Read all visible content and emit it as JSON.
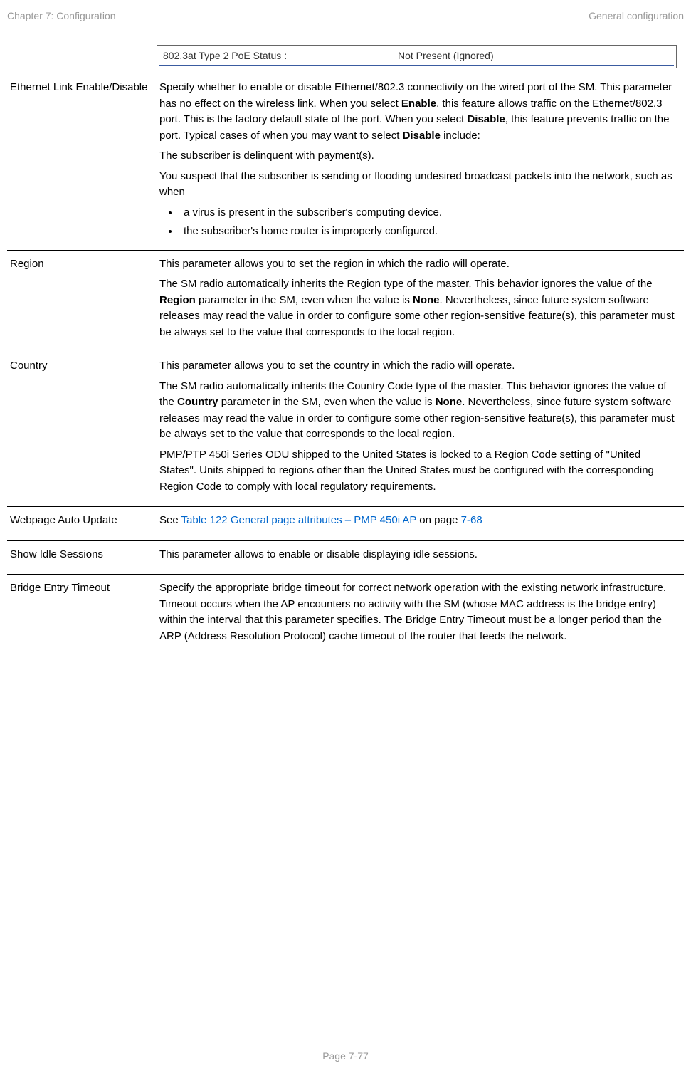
{
  "header": {
    "left": "Chapter 7:  Configuration",
    "right": "General configuration"
  },
  "status": {
    "label": "802.3at Type 2 PoE Status :",
    "value": "Not Present (Ignored)"
  },
  "rows": [
    {
      "term": "Ethernet Link Enable/Disable",
      "paragraphs": [
        {
          "segments": [
            {
              "t": "Specify whether to enable or disable Ethernet/802.3 connectivity on the wired port of the SM. This parameter has no effect on the wireless link. When you select "
            },
            {
              "t": "Enable",
              "bold": true
            },
            {
              "t": ", this feature allows traffic on the Ethernet/802.3 port. This is the factory default state of the port. When you select "
            },
            {
              "t": "Disable",
              "bold": true
            },
            {
              "t": ", this feature prevents traffic on the port. Typical cases of when you may want to select "
            },
            {
              "t": "Disable",
              "bold": true
            },
            {
              "t": " include:"
            }
          ]
        },
        {
          "segments": [
            {
              "t": "The subscriber is delinquent with payment(s)."
            }
          ]
        },
        {
          "segments": [
            {
              "t": "You suspect that the subscriber is sending or flooding undesired broadcast packets into the network, such as when"
            }
          ]
        }
      ],
      "bullets": [
        "a virus is present in the subscriber's computing device.",
        "the subscriber's home router is improperly configured."
      ]
    },
    {
      "term": "Region",
      "paragraphs": [
        {
          "segments": [
            {
              "t": "This parameter allows you to set the region in which the radio will operate."
            }
          ]
        },
        {
          "segments": [
            {
              "t": "The SM radio automatically inherits the Region type of the master. This behavior ignores the value of the "
            },
            {
              "t": "Region",
              "bold": true
            },
            {
              "t": " parameter in the SM, even when the value is "
            },
            {
              "t": "None",
              "bold": true
            },
            {
              "t": ". Nevertheless, since future system software releases may read the value in order to configure some other region-sensitive feature(s), this parameter must be always set to the value that corresponds to the local region."
            }
          ]
        }
      ]
    },
    {
      "term": "Country",
      "paragraphs": [
        {
          "segments": [
            {
              "t": "This parameter allows you to set the country in which the radio will operate."
            }
          ]
        },
        {
          "segments": [
            {
              "t": "The SM radio automatically inherits the Country Code type of the master. This behavior ignores the value of the "
            },
            {
              "t": "Country",
              "bold": true
            },
            {
              "t": " parameter in the SM, even when the value is "
            },
            {
              "t": "None",
              "bold": true
            },
            {
              "t": ". Nevertheless, since future system software releases may read the value in order to configure some other region-sensitive feature(s), this parameter must be always set to the value that corresponds to the local region."
            }
          ]
        },
        {
          "segments": [
            {
              "t": "PMP/PTP 450i Series ODU shipped to the United States is locked to a Region Code setting of \"United States\". Units shipped to regions other than the United States must be configured with the corresponding Region Code to comply with local regulatory requirements."
            }
          ]
        }
      ]
    },
    {
      "term": "Webpage Auto Update",
      "paragraphs": [
        {
          "segments": [
            {
              "t": "See "
            },
            {
              "t": "Table 122 General page attributes – PMP 450i AP",
              "link": true
            },
            {
              "t": " on page "
            },
            {
              "t": "7-68",
              "link": true
            }
          ]
        }
      ]
    },
    {
      "term": "Show Idle Sessions",
      "paragraphs": [
        {
          "segments": [
            {
              "t": "This parameter allows to enable or disable displaying idle sessions."
            }
          ]
        }
      ]
    },
    {
      "term": "Bridge Entry Timeout",
      "paragraphs": [
        {
          "segments": [
            {
              "t": "Specify the appropriate bridge timeout for correct network operation with the existing network infrastructure. Timeout occurs when the AP encounters no activity with the SM (whose MAC address is the bridge entry) within the interval that this parameter specifies. The Bridge Entry Timeout must be a longer period than the ARP (Address Resolution Protocol) cache timeout of the router that feeds the network."
            }
          ]
        }
      ]
    }
  ],
  "footer": "Page 7-77"
}
